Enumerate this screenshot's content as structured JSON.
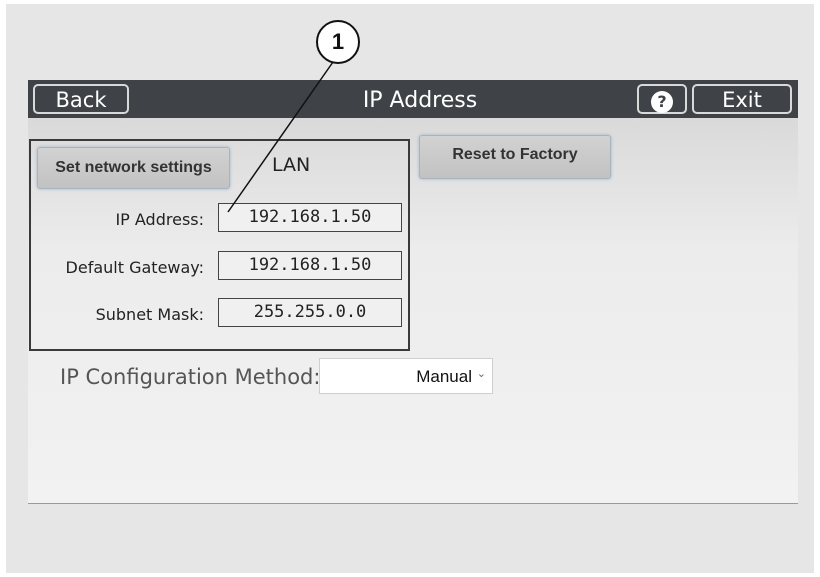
{
  "header": {
    "back_label": "Back",
    "title": "IP Address",
    "help_icon": "question-mark-icon",
    "help_symbol": "?",
    "exit_label": "Exit"
  },
  "lan_panel": {
    "set_network_label": "Set network settings",
    "section_label": "LAN",
    "rows": [
      {
        "label": "IP Address:",
        "value": "192.168.1.50"
      },
      {
        "label": "Default Gateway:",
        "value": "192.168.1.50"
      },
      {
        "label": "Subnet Mask:",
        "value": "255.255.0.0"
      }
    ]
  },
  "reset_label": "Reset to Factory",
  "config": {
    "label": "IP Configuration Method:",
    "selected": "Manual",
    "chevron_icon": "chevron-down-icon"
  },
  "callout": {
    "number": "1"
  },
  "colors": {
    "header_bg": "#3f4347",
    "screen_bg": "#ececec"
  }
}
